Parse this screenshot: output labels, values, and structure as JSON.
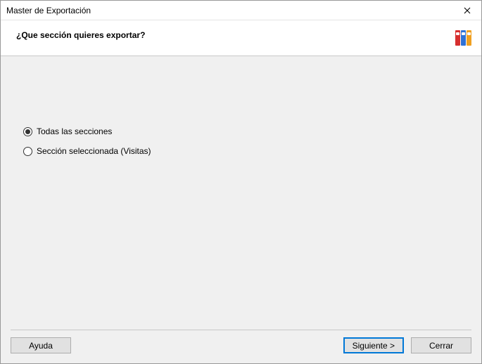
{
  "window": {
    "title": "Master de Exportación"
  },
  "header": {
    "question": "¿Que sección quieres exportar?"
  },
  "options": {
    "all_sections": "Todas las secciones",
    "selected_section": "Sección seleccionada (Visitas)"
  },
  "buttons": {
    "help": "Ayuda",
    "next": "Siguiente >",
    "close": "Cerrar"
  }
}
